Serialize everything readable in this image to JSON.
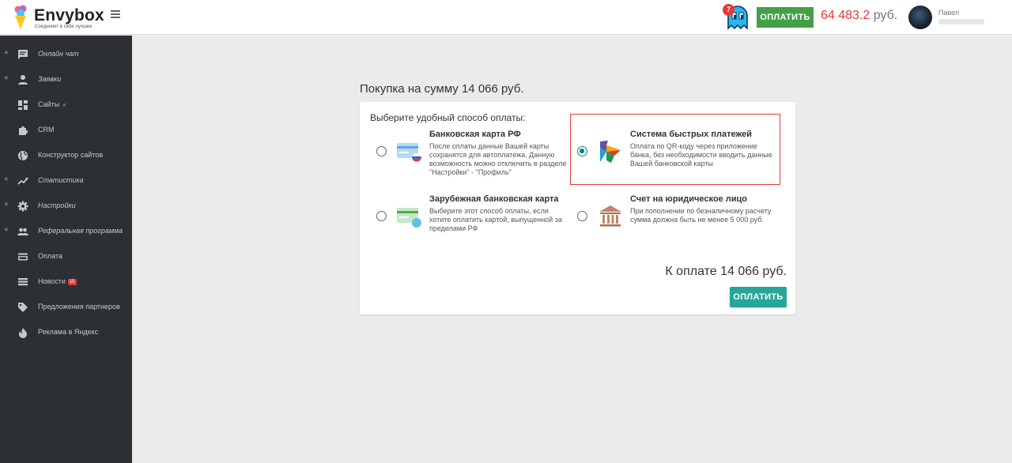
{
  "header": {
    "brand_name": "Envybox",
    "brand_tagline": "Соединяет в себе лучшее",
    "notifications_count": "7",
    "pay_button_label": "ОПЛАТИТЬ",
    "balance_amount": "64 483.2",
    "balance_currency": "руб.",
    "user_name": "Павел"
  },
  "sidebar": {
    "items": [
      {
        "label": "Онлайн чат",
        "icon": "chat-icon",
        "expandable": true,
        "italic": true
      },
      {
        "label": "Заявки",
        "icon": "person-icon",
        "expandable": true,
        "italic": true
      },
      {
        "label": "Сайты",
        "icon": "dashboard-icon",
        "expandable": false,
        "italic": false,
        "star": "★"
      },
      {
        "label": "CRM",
        "icon": "puzzle-icon",
        "expandable": false,
        "italic": false
      },
      {
        "label": "Конструктор сайтов",
        "icon": "globe-icon",
        "expandable": false,
        "italic": false
      },
      {
        "label": "Статистика",
        "icon": "trending-icon",
        "expandable": true,
        "italic": true
      },
      {
        "label": "Настройки",
        "icon": "gear-icon",
        "expandable": true,
        "italic": true
      },
      {
        "label": "Реферальная программа",
        "icon": "group-icon",
        "expandable": true,
        "italic": true
      },
      {
        "label": "Оплата",
        "icon": "card-icon",
        "expandable": false,
        "italic": false
      },
      {
        "label": "Новости",
        "icon": "news-icon",
        "expandable": false,
        "italic": false,
        "badge": "15"
      },
      {
        "label": "Предложения партнеров",
        "icon": "tag-icon",
        "expandable": false,
        "italic": false
      },
      {
        "label": "Реклама в Яндекс",
        "icon": "fire-icon",
        "expandable": false,
        "italic": false
      }
    ]
  },
  "payment": {
    "purchase_title": "Покупка на сумму 14 066 руб.",
    "choose_label": "Выберите удобный способ оплаты:",
    "options": [
      {
        "title": "Банковская карта РФ",
        "description": "После оплаты данные Вашей карты сохранятся для автоплатежа. Данную возможность можно отключить в разделе \"Настройки\" - \"Профиль\"",
        "icon": "bank-card-ru-icon",
        "selected": false
      },
      {
        "title": "Система быстрых платежей",
        "description": "Оплата по QR-коду через приложение банка, без необходимости вводить данные Вашей банковской карты",
        "icon": "sbp-icon",
        "selected": true
      },
      {
        "title": "Зарубежная банковская карта",
        "description": "Выберите этот способ оплаты, если хотите оплатить картой, выпущенной за пределами РФ",
        "icon": "foreign-card-icon",
        "selected": false
      },
      {
        "title": "Счет на юридическое лицо",
        "description": "При пополнении по безналичному расчету сумма должна быть не менее 5 000 руб.",
        "icon": "bank-building-icon",
        "selected": false
      }
    ],
    "total_label": "К оплате 14 066 руб.",
    "pay_button_label": "ОПЛАТИТЬ"
  },
  "colors": {
    "accent_teal": "#26a69a",
    "pay_green": "#43a047",
    "balance_red": "#e53935",
    "sidebar_bg": "#2c3035"
  }
}
